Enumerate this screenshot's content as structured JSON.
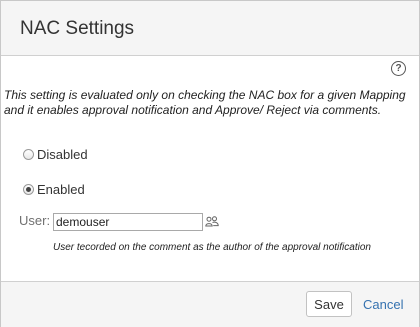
{
  "dialog": {
    "title": "NAC Settings",
    "help_icon": "help-question-icon",
    "description": "This setting is evaluated only on checking the NAC box for a given Mapping and it enables approval notification and Approve/ Reject via comments."
  },
  "options": {
    "disabled_label": "Disabled",
    "enabled_label": "Enabled",
    "selected": "Enabled"
  },
  "user": {
    "label": "User:",
    "value": "demouser",
    "picker_icon": "user-group-icon",
    "hint": "User tecorded on the comment as the author of the approval notification"
  },
  "footer": {
    "save_label": "Save",
    "cancel_label": "Cancel"
  },
  "colors": {
    "link": "#3572b0",
    "header_bg": "#f5f5f5"
  }
}
